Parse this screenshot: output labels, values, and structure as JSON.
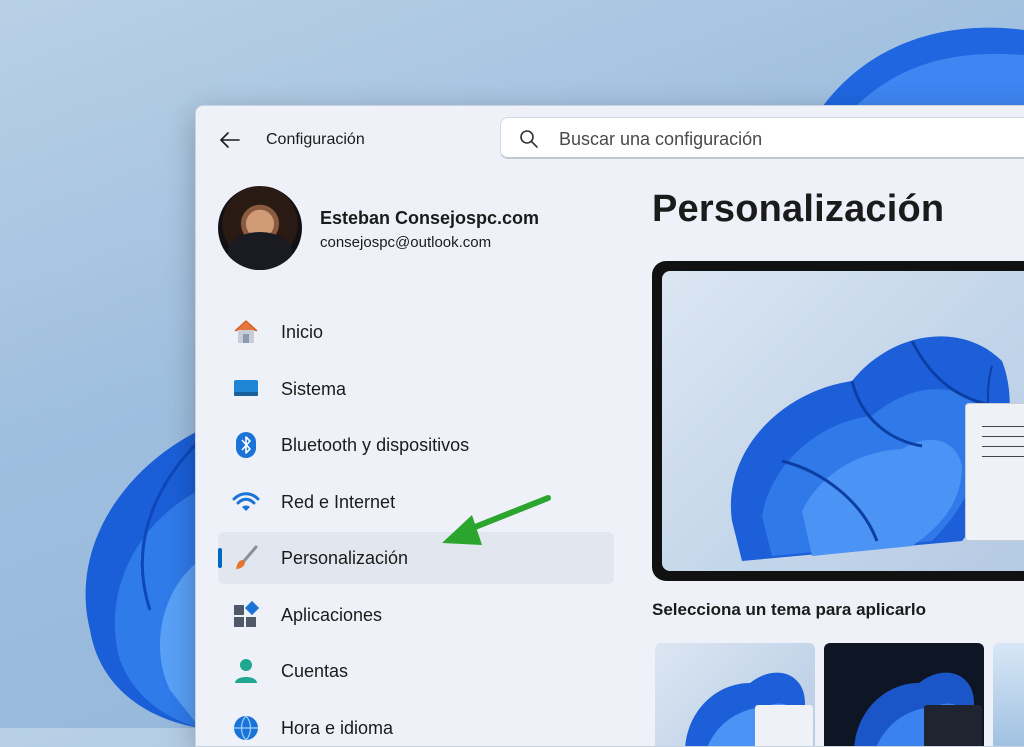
{
  "window": {
    "title": "Configuración"
  },
  "search": {
    "placeholder": "Buscar una configuración"
  },
  "profile": {
    "name": "Esteban Consejospc.com",
    "email": "consejospc@outlook.com"
  },
  "nav": {
    "items": [
      {
        "label": "Inicio",
        "icon": "home-icon"
      },
      {
        "label": "Sistema",
        "icon": "system-icon"
      },
      {
        "label": "Bluetooth y dispositivos",
        "icon": "bluetooth-icon"
      },
      {
        "label": "Red e Internet",
        "icon": "wifi-icon"
      },
      {
        "label": "Personalización",
        "icon": "paintbrush-icon",
        "selected": true
      },
      {
        "label": "Aplicaciones",
        "icon": "apps-icon"
      },
      {
        "label": "Cuentas",
        "icon": "account-icon"
      },
      {
        "label": "Hora e idioma",
        "icon": "globe-icon"
      }
    ]
  },
  "main": {
    "title": "Personalización",
    "section_heading": "Selecciona un tema para aplicarlo",
    "themes": [
      {
        "name": "theme-light"
      },
      {
        "name": "theme-dark"
      },
      {
        "name": "theme-third"
      }
    ]
  },
  "colors": {
    "accent": "#0067c0",
    "annotation_arrow": "#2ba52e"
  }
}
